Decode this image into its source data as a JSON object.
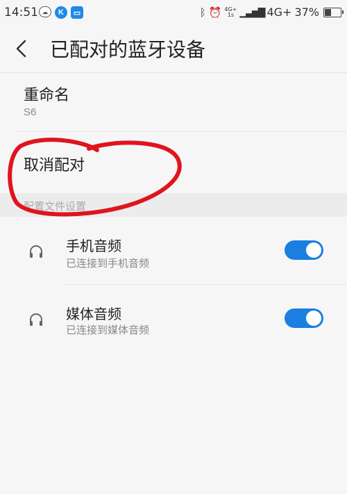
{
  "status_bar": {
    "time": "14:51",
    "network": "4G+",
    "network_small_top": "4G+",
    "network_small_bottom": "1s",
    "battery": "37%",
    "battery_level": 0.37,
    "icons": [
      "cloud-oval-icon",
      "k-app-icon",
      "message-icon",
      "bluetooth-icon",
      "alarm-icon",
      "signal-icon"
    ]
  },
  "header": {
    "title": "已配对的蓝牙设备"
  },
  "rename": {
    "label": "重命名",
    "value": "S6"
  },
  "unpair": {
    "label": "取消配对"
  },
  "section": {
    "label": "配置文件设置"
  },
  "profiles": [
    {
      "title": "手机音频",
      "subtitle": "已连接到手机音频",
      "icon": "headphones-icon",
      "enabled": true
    },
    {
      "title": "媒体音频",
      "subtitle": "已连接到媒体音频",
      "icon": "headphones-icon",
      "enabled": true
    }
  ],
  "colors": {
    "toggle_on": "#1a7fe0",
    "annotation": "#e0141e"
  }
}
